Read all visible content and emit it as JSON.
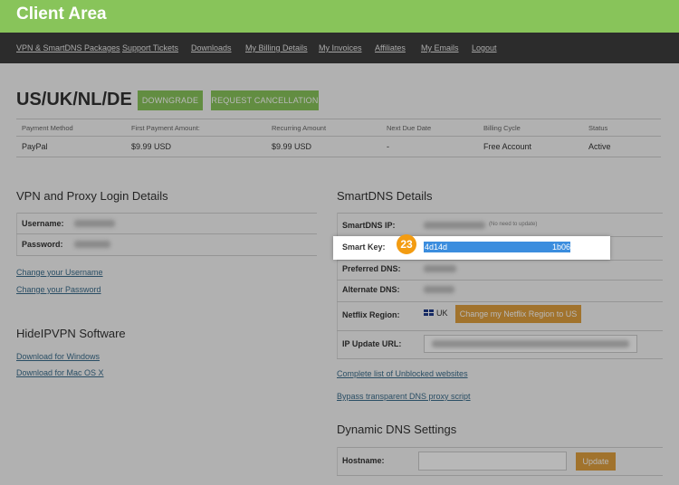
{
  "header": {
    "title": "Client Area"
  },
  "nav": {
    "items": [
      "VPN & SmartDNS Packages",
      "Support Tickets",
      "Downloads",
      "My Billing Details",
      "My Invoices",
      "Affiliates",
      "My Emails",
      "Logout"
    ]
  },
  "package": {
    "title": "US/UK/NL/DE",
    "downgrade_label": "DOWNGRADE",
    "cancel_label": "REQUEST CANCELLATION"
  },
  "billing": {
    "headers": [
      "Payment Method",
      "First Payment Amount:",
      "Recurring Amount",
      "Next Due Date",
      "Billing Cycle",
      "Status"
    ],
    "values": [
      "PayPal",
      "$9.99 USD",
      "$9.99 USD",
      "-",
      "Free Account",
      "Active"
    ]
  },
  "vpn": {
    "title": "VPN and Proxy Login Details",
    "username_label": "Username:",
    "password_label": "Password:",
    "change_username": "Change your Username",
    "change_password": "Change your Password"
  },
  "software": {
    "title": "HideIPVPN Software",
    "windows": "Download for Windows",
    "mac": "Download for Mac OS X"
  },
  "smartdns": {
    "title": "SmartDNS Details",
    "ip_label": "SmartDNS IP:",
    "ip_note": "(No need to update)",
    "key_label": "Smart Key:",
    "key_start": "4d14d",
    "key_end": "1b06",
    "preferred_label": "Preferred DNS:",
    "alternate_label": "Alternate DNS:",
    "netflix_label": "Netflix Region:",
    "netflix_region": "UK",
    "netflix_button": "Change my Netflix Region to US",
    "ip_update_label": "IP Update URL:",
    "unblocked_link": "Complete list of Unblocked websites",
    "bypass_link": "Bypass transparent DNS proxy script"
  },
  "ddns": {
    "title": "Dynamic DNS Settings",
    "hostname_label": "Hostname:",
    "update_label": "Update"
  },
  "tutorial": {
    "step": "23"
  },
  "colors": {
    "brand_green": "#88c45a",
    "nav_dark": "#3e3e3e",
    "accent_orange": "#e0a03f",
    "badge_orange": "#f39c12",
    "selection_blue": "#3b8dde"
  }
}
